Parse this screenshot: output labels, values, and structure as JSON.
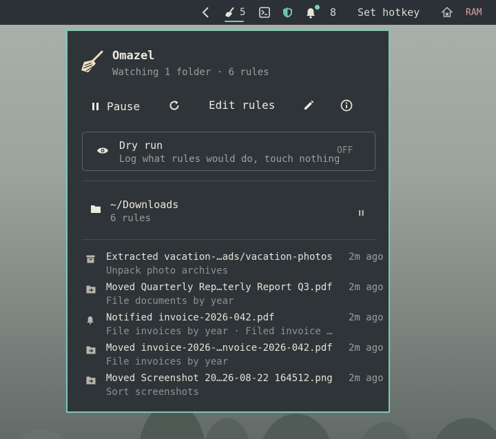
{
  "topbar": {
    "back_icon": "chevron-left-icon",
    "broom_count": "5",
    "notification_count": "8",
    "hotkey_label": "Set hotkey",
    "ram_label": "RAM",
    "accent": "#7fc7b7"
  },
  "app": {
    "title": "Omazel",
    "subtitle": "Watching 1 folder · 6 rules"
  },
  "controls": {
    "pause_label": "Pause",
    "edit_rules_label": "Edit rules"
  },
  "dry_run": {
    "title": "Dry run",
    "subtitle": "Log what rules would do, touch nothing",
    "state": "OFF"
  },
  "folder": {
    "name": "~/Downloads",
    "rules": "6 rules"
  },
  "log": [
    {
      "icon": "archive-icon",
      "title": "Extracted vacation-…ads/vacation-photos",
      "sub": "Unpack photo archives",
      "time": "2m ago"
    },
    {
      "icon": "folder-move-icon",
      "title": "Moved Quarterly Rep…terly Report Q3.pdf",
      "sub": "File documents by year",
      "time": "2m ago"
    },
    {
      "icon": "bell-icon",
      "title": "Notified invoice-2026-042.pdf",
      "sub": "File invoices by year · Filed invoice …",
      "time": "2m ago"
    },
    {
      "icon": "folder-move-icon",
      "title": "Moved invoice-2026-…nvoice-2026-042.pdf",
      "sub": "File invoices by year",
      "time": "2m ago"
    },
    {
      "icon": "folder-move-icon",
      "title": "Moved Screenshot 20…26-08-22 164512.png",
      "sub": "Sort screenshots",
      "time": "2m ago"
    }
  ]
}
